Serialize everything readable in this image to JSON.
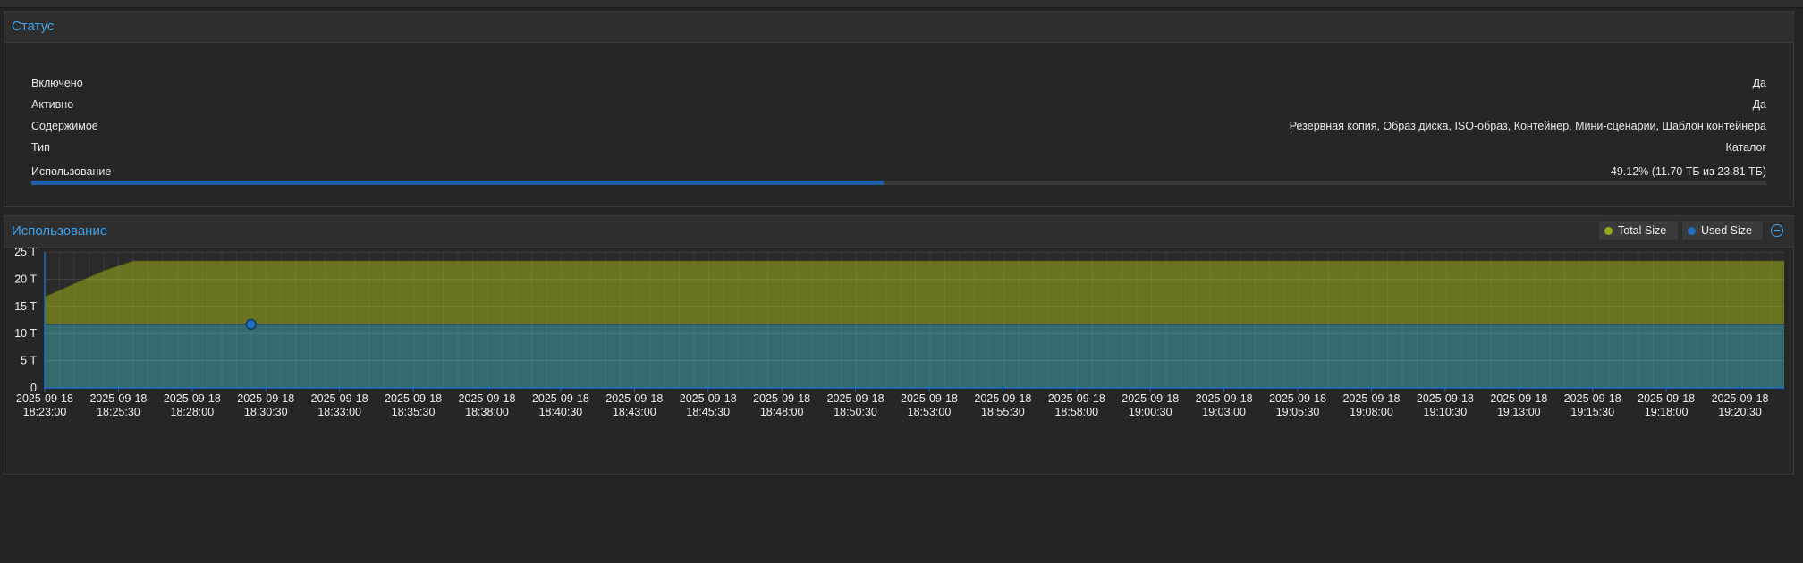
{
  "status_panel": {
    "title": "Статус",
    "rows": [
      {
        "label": "Включено",
        "value": "Да"
      },
      {
        "label": "Активно",
        "value": "Да"
      },
      {
        "label": "Содержимое",
        "value": "Резервная копия, Образ диска, ISO-образ, Контейнер, Мини-сценарии, Шаблон контейнера"
      },
      {
        "label": "Тип",
        "value": "Каталог"
      }
    ],
    "usage_label": "Использование",
    "usage_value": "49.12% (11.70 ТБ из 23.81 ТБ)",
    "usage_fraction": 0.4912
  },
  "usage_panel": {
    "title": "Использование",
    "legend": [
      {
        "label": "Total Size",
        "color": "#9aaa16"
      },
      {
        "label": "Used Size",
        "color": "#1f6ec2"
      }
    ]
  },
  "colors": {
    "accent": "#3fa5ee",
    "total_fill": "#6b7220",
    "used_fill": "#336b70",
    "progress": "#1c5fa8"
  },
  "chart_data": {
    "type": "area",
    "ylim": [
      0,
      25
    ],
    "yticks": [
      "0",
      "5 T",
      "10 T",
      "15 T",
      "20 T",
      "25 T"
    ],
    "ytick_values": [
      0,
      5,
      10,
      15,
      20,
      25
    ],
    "xtick_dates": [
      "2025-09-18",
      "2025-09-18",
      "2025-09-18",
      "2025-09-18",
      "2025-09-18",
      "2025-09-18",
      "2025-09-18",
      "2025-09-18",
      "2025-09-18",
      "2025-09-18",
      "2025-09-18",
      "2025-09-18",
      "2025-09-18",
      "2025-09-18",
      "2025-09-18",
      "2025-09-18",
      "2025-09-18",
      "2025-09-18",
      "2025-09-18",
      "2025-09-18",
      "2025-09-18",
      "2025-09-18",
      "2025-09-18",
      "2025-09-18"
    ],
    "xtick_times": [
      "18:23:00",
      "18:25:30",
      "18:28:00",
      "18:30:30",
      "18:33:00",
      "18:35:30",
      "18:38:00",
      "18:40:30",
      "18:43:00",
      "18:45:30",
      "18:48:00",
      "18:50:30",
      "18:53:00",
      "18:55:30",
      "18:58:00",
      "19:00:30",
      "19:03:00",
      "19:05:30",
      "19:08:00",
      "19:10:30",
      "19:13:00",
      "19:15:30",
      "19:18:00",
      "19:20:30"
    ],
    "x_range": [
      "18:23:00",
      "19:22:00"
    ],
    "series": [
      {
        "name": "Total Size",
        "x": [
          "18:23:00",
          "18:25:00",
          "18:26:00",
          "19:22:00"
        ],
        "values": [
          16.8,
          21.6,
          23.4,
          23.4
        ]
      },
      {
        "name": "Used Size",
        "x": [
          "18:23:00",
          "19:22:00"
        ],
        "values": [
          11.7,
          11.7
        ]
      }
    ],
    "highlight": {
      "series": "Used Size",
      "x": "18:30:00",
      "value": 11.7
    },
    "grid": true
  }
}
